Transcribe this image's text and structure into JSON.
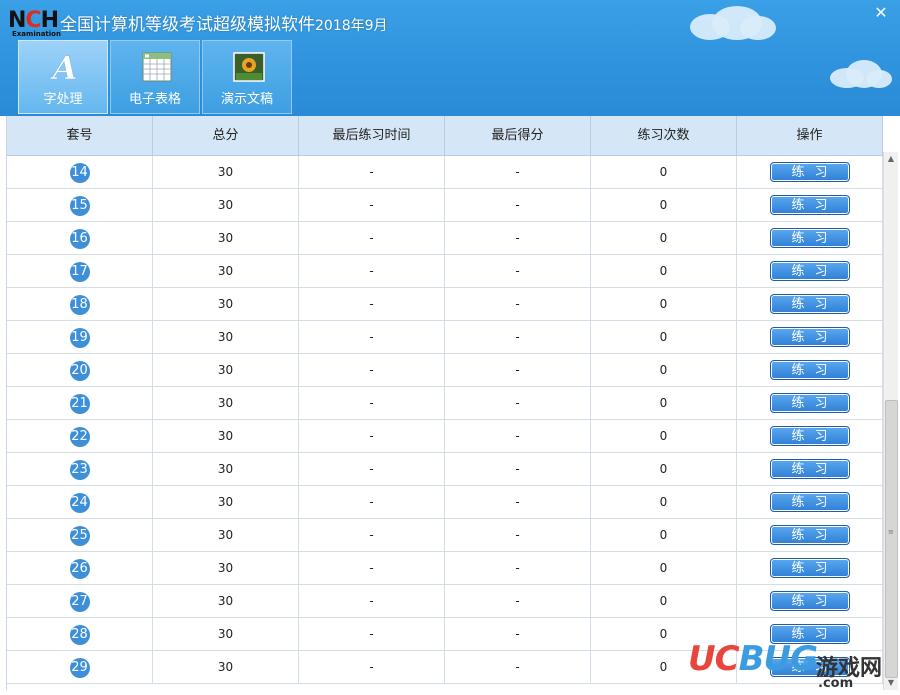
{
  "window": {
    "title": "全国计算机等级考试超级模拟软件",
    "date_label": "2018年9月",
    "close_glyph": "✕"
  },
  "logo": {
    "n1": "N",
    "c": "C",
    "n2": "H",
    "sub": "Examination"
  },
  "tabs": [
    {
      "label": "字处理",
      "icon": "word-icon",
      "active": true
    },
    {
      "label": "电子表格",
      "icon": "spreadsheet-icon",
      "active": false
    },
    {
      "label": "演示文稿",
      "icon": "presentation-icon",
      "active": false
    }
  ],
  "table": {
    "headers": [
      "套号",
      "总分",
      "最后练习时间",
      "最后得分",
      "练习次数",
      "操作"
    ],
    "button_label": "练习",
    "rows": [
      {
        "set": "14",
        "total": "30",
        "last_time": "-",
        "last_score": "-",
        "count": "0"
      },
      {
        "set": "15",
        "total": "30",
        "last_time": "-",
        "last_score": "-",
        "count": "0"
      },
      {
        "set": "16",
        "total": "30",
        "last_time": "-",
        "last_score": "-",
        "count": "0"
      },
      {
        "set": "17",
        "total": "30",
        "last_time": "-",
        "last_score": "-",
        "count": "0"
      },
      {
        "set": "18",
        "total": "30",
        "last_time": "-",
        "last_score": "-",
        "count": "0"
      },
      {
        "set": "19",
        "total": "30",
        "last_time": "-",
        "last_score": "-",
        "count": "0"
      },
      {
        "set": "20",
        "total": "30",
        "last_time": "-",
        "last_score": "-",
        "count": "0"
      },
      {
        "set": "21",
        "total": "30",
        "last_time": "-",
        "last_score": "-",
        "count": "0"
      },
      {
        "set": "22",
        "total": "30",
        "last_time": "-",
        "last_score": "-",
        "count": "0"
      },
      {
        "set": "23",
        "total": "30",
        "last_time": "-",
        "last_score": "-",
        "count": "0"
      },
      {
        "set": "24",
        "total": "30",
        "last_time": "-",
        "last_score": "-",
        "count": "0"
      },
      {
        "set": "25",
        "total": "30",
        "last_time": "-",
        "last_score": "-",
        "count": "0"
      },
      {
        "set": "26",
        "total": "30",
        "last_time": "-",
        "last_score": "-",
        "count": "0"
      },
      {
        "set": "27",
        "total": "30",
        "last_time": "-",
        "last_score": "-",
        "count": "0"
      },
      {
        "set": "28",
        "total": "30",
        "last_time": "-",
        "last_score": "-",
        "count": "0"
      },
      {
        "set": "29",
        "total": "30",
        "last_time": "-",
        "last_score": "-",
        "count": "0"
      }
    ]
  },
  "colors": {
    "header_blue": "#2f93dd",
    "table_header_bg": "#d5e6f6",
    "badge_blue": "#3d8fd8",
    "button_blue": "#2f7fd6"
  },
  "watermark": {
    "uc": "UC",
    "bug": "BUG",
    "cn": "游戏网",
    "com": ".com"
  }
}
